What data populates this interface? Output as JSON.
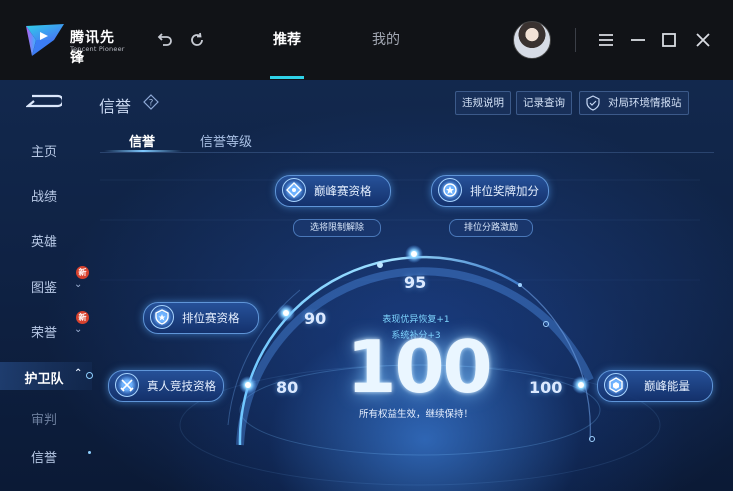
{
  "app": {
    "brand_cn": "腾讯先锋",
    "brand_en": "Tencent Pioneer",
    "nav": {
      "tabs": [
        {
          "label": "推荐",
          "active": true
        },
        {
          "label": "我的",
          "active": false
        }
      ]
    },
    "accent": "#2fd2e8"
  },
  "sidebar": {
    "items": [
      {
        "label": "主页"
      },
      {
        "label": "战绩"
      },
      {
        "label": "英雄"
      },
      {
        "label": "图鉴",
        "badge": "新"
      },
      {
        "label": "荣誉",
        "badge": "新"
      },
      {
        "label": "护卫队",
        "active": true
      },
      {
        "label": "审判"
      },
      {
        "label": "信誉"
      }
    ]
  },
  "header": {
    "title": "信誉",
    "buttons": [
      "违规说明",
      "记录查询",
      "对局环境情报站"
    ]
  },
  "tabs": [
    {
      "label": "信誉",
      "active": true
    },
    {
      "label": "信誉等级",
      "active": false
    }
  ],
  "credit": {
    "score": "100",
    "ticks": [
      "80",
      "90",
      "95",
      "100"
    ],
    "bonus_1": "表现优异恢复+1",
    "bonus_2": "系统补分+3",
    "note": "所有权益生效，继续保持！",
    "privileges": [
      {
        "label": "巅峰赛资格"
      },
      {
        "label": "排位奖牌加分"
      },
      {
        "label": "排位赛资格"
      },
      {
        "label": "真人竞技资格"
      },
      {
        "label": "巅峰能量"
      }
    ],
    "sub_privileges": [
      "选将限制解除",
      "排位分路激励"
    ]
  }
}
